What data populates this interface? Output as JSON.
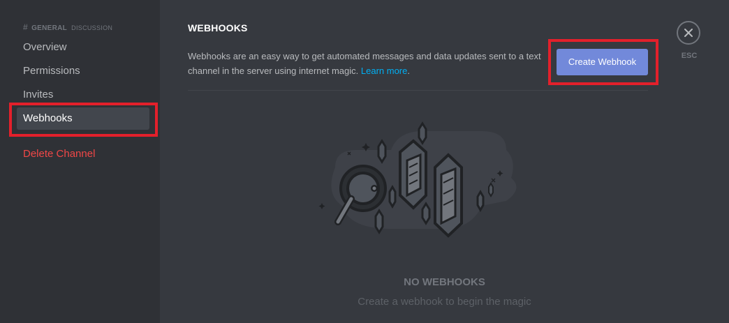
{
  "sidebar": {
    "header": {
      "hash": "#",
      "channel": "GENERAL",
      "category": "DISCUSSION"
    },
    "items": [
      {
        "label": "Overview"
      },
      {
        "label": "Permissions"
      },
      {
        "label": "Invites"
      },
      {
        "label": "Webhooks",
        "selected": true
      },
      {
        "label": "Delete Channel",
        "danger": true
      }
    ]
  },
  "main": {
    "title": "WEBHOOKS",
    "description": "Webhooks are an easy way to get automated messages and data updates sent to a text channel in the server using internet magic.",
    "learn_more": "Learn more",
    "description_end": ".",
    "create_button": "Create Webhook",
    "close_label": "ESC",
    "empty_title": "NO WEBHOOKS",
    "empty_subtitle": "Create a webhook to begin the magic"
  },
  "colors": {
    "accent": "#7289da",
    "danger": "#f04747",
    "link": "#00b0f4",
    "annotation": "#e3202b"
  },
  "icons": {
    "close": "close-icon",
    "hash": "hash-icon",
    "illustration": "webhook-empty-state-illustration"
  }
}
